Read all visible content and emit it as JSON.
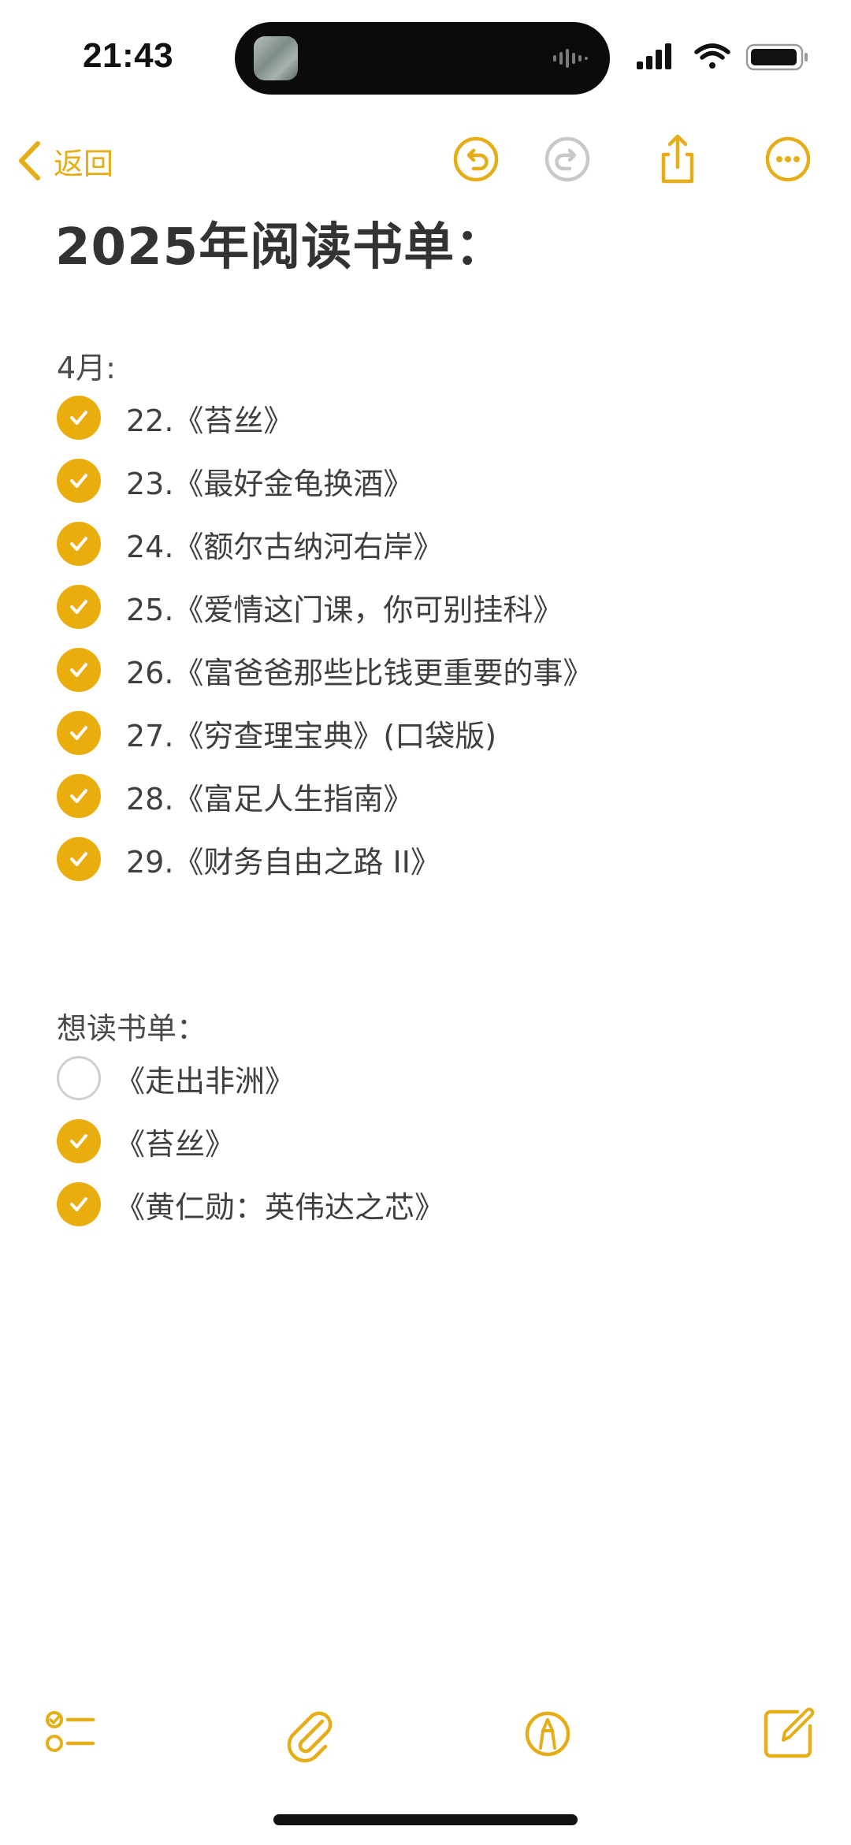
{
  "status_bar": {
    "time": "21:43"
  },
  "nav": {
    "back_label": "返回"
  },
  "note": {
    "title": "2025年阅读书单：",
    "april": {
      "label": "4月:",
      "items": [
        {
          "text": "22.《苔丝》",
          "checked": true
        },
        {
          "text": "23.《最好金龟换酒》",
          "checked": true
        },
        {
          "text": "24.《额尔古纳河右岸》",
          "checked": true
        },
        {
          "text": "25.《爱情这门课，你可别挂科》",
          "checked": true
        },
        {
          "text": "26.《富爸爸那些比钱更重要的事》",
          "checked": true
        },
        {
          "text": "27.《穷查理宝典》(口袋版)",
          "checked": true
        },
        {
          "text": "28.《富足人生指南》",
          "checked": true
        },
        {
          "text": "29.《财务自由之路 II》",
          "checked": true
        }
      ]
    },
    "wishlist": {
      "label": "想读书单：",
      "items": [
        {
          "text": "《走出非洲》",
          "checked": false
        },
        {
          "text": "《苔丝》",
          "checked": true
        },
        {
          "text": "《黄仁勋：英伟达之芯》",
          "checked": true
        }
      ]
    }
  },
  "colors": {
    "accent": "#e5ad16",
    "check_fill": "#e9ae0e",
    "disabled": "#c8c8c8"
  },
  "icons": {
    "nav": [
      "chevron-left-icon",
      "undo-icon",
      "redo-icon",
      "share-icon",
      "more-icon"
    ],
    "toolbar": [
      "checklist-icon",
      "attachment-icon",
      "markup-icon",
      "compose-icon"
    ]
  }
}
